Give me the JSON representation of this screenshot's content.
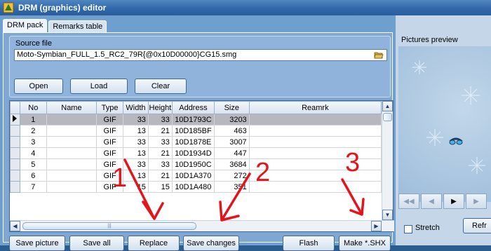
{
  "window": {
    "title": "DRM (graphics) editor"
  },
  "tabs": [
    {
      "label": "DRM pack",
      "active": true
    },
    {
      "label": "Remarks table",
      "active": false
    }
  ],
  "source": {
    "label": "Source file",
    "value": "Moto-Symbian_FULL_1.5_RC2_79R{@0x10D00000}CG15.smg",
    "buttons": {
      "open": "Open",
      "load": "Load",
      "clear": "Clear"
    }
  },
  "grid": {
    "columns": [
      "No",
      "Name",
      "Type",
      "Width",
      "Height",
      "Address",
      "Size",
      "Reamrk"
    ],
    "rows": [
      {
        "no": "1",
        "name": "",
        "type": "GIF",
        "width": "33",
        "height": "33",
        "address": "10D1793C",
        "size": "3203",
        "remark": "",
        "selected": true
      },
      {
        "no": "2",
        "name": "",
        "type": "GIF",
        "width": "13",
        "height": "21",
        "address": "10D185BF",
        "size": "463",
        "remark": ""
      },
      {
        "no": "3",
        "name": "",
        "type": "GIF",
        "width": "33",
        "height": "33",
        "address": "10D1878E",
        "size": "3007",
        "remark": ""
      },
      {
        "no": "4",
        "name": "",
        "type": "GIF",
        "width": "13",
        "height": "21",
        "address": "10D1934D",
        "size": "447",
        "remark": ""
      },
      {
        "no": "5",
        "name": "",
        "type": "GIF",
        "width": "33",
        "height": "33",
        "address": "10D1950C",
        "size": "3684",
        "remark": ""
      },
      {
        "no": "6",
        "name": "",
        "type": "GIF",
        "width": "13",
        "height": "21",
        "address": "10D1A370",
        "size": "272",
        "remark": ""
      },
      {
        "no": "7",
        "name": "",
        "type": "GIF",
        "width": "15",
        "height": "15",
        "address": "10D1A480",
        "size": "351",
        "remark": ""
      }
    ]
  },
  "bottom_buttons": {
    "save_picture": "Save picture",
    "save_all": "Save all",
    "replace": "Replace",
    "save_changes": "Save changes",
    "flash": "Flash",
    "make_shx": "Make *.SHX"
  },
  "annotations": [
    "1",
    "2",
    "3"
  ],
  "preview": {
    "label": "Pictures preview",
    "stretch_label": "Stretch",
    "stretch_checked": false,
    "refresh_label": "Refr"
  },
  "colors": {
    "accent": "#2e66a8",
    "annotation_red": "#e5141b",
    "selected_row": "#b7b7bf"
  }
}
